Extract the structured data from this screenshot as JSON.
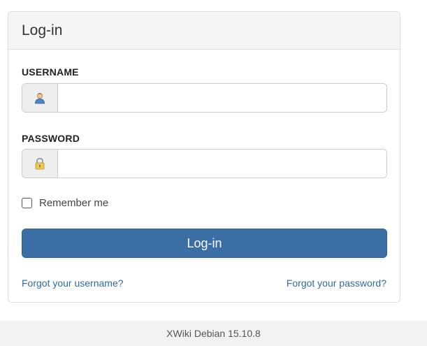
{
  "panel": {
    "title": "Log-in"
  },
  "form": {
    "username_label": "USERNAME",
    "username_value": "",
    "username_icon": "user-icon",
    "password_label": "PASSWORD",
    "password_value": "",
    "password_icon": "lock-icon",
    "remember_label": "Remember me",
    "remember_checked": false,
    "login_button_label": "Log-in"
  },
  "links": {
    "forgot_username": "Forgot your username?",
    "forgot_password": "Forgot your password?"
  },
  "footer": {
    "text": "XWiki Debian 15.10.8"
  },
  "colors": {
    "accent": "#3a6ea5",
    "link": "#2e6aa0",
    "heading_bg": "#f5f5f5"
  }
}
